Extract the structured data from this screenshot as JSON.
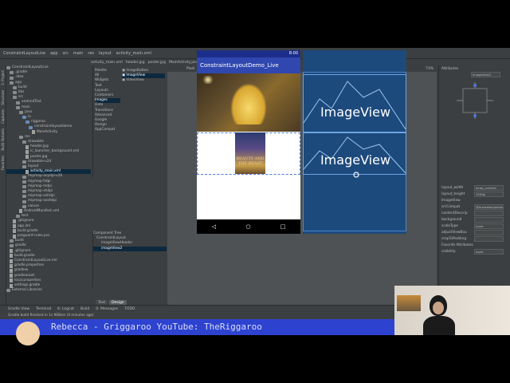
{
  "ide": {
    "top_tabs": [
      "ConstraintLayoutLive",
      "app",
      "src",
      "main",
      "res",
      "layout",
      "activity_main.xml"
    ],
    "editor_tabs": [
      "activity_main.xml",
      "header.jpg",
      "poster.jpg",
      "MainActivity.java",
      "app"
    ],
    "project_tree": [
      {
        "label": "ConstraintLayoutLive",
        "indent": 0,
        "kind": "folder"
      },
      {
        "label": ".gradle",
        "indent": 1,
        "kind": "folder"
      },
      {
        "label": ".idea",
        "indent": 1,
        "kind": "folder"
      },
      {
        "label": "app",
        "indent": 1,
        "kind": "folder"
      },
      {
        "label": "build",
        "indent": 2,
        "kind": "folder"
      },
      {
        "label": "libs",
        "indent": 2,
        "kind": "folder"
      },
      {
        "label": "src",
        "indent": 2,
        "kind": "folder"
      },
      {
        "label": "androidTest",
        "indent": 3,
        "kind": "folder"
      },
      {
        "label": "main",
        "indent": 3,
        "kind": "folder"
      },
      {
        "label": "java",
        "indent": 4,
        "kind": "folder"
      },
      {
        "label": "io",
        "indent": 5,
        "kind": "folder-blue"
      },
      {
        "label": "riggaroo",
        "indent": 6,
        "kind": "folder-blue"
      },
      {
        "label": "constraintlayoutdemo",
        "indent": 7,
        "kind": "folder-blue"
      },
      {
        "label": "MainActivity",
        "indent": 8,
        "kind": "file"
      },
      {
        "label": "res",
        "indent": 4,
        "kind": "folder"
      },
      {
        "label": "drawable",
        "indent": 5,
        "kind": "folder"
      },
      {
        "label": "header.jpg",
        "indent": 6,
        "kind": "file"
      },
      {
        "label": "ic_launcher_background.xml",
        "indent": 6,
        "kind": "file"
      },
      {
        "label": "poster.jpg",
        "indent": 6,
        "kind": "file"
      },
      {
        "label": "drawable-v24",
        "indent": 5,
        "kind": "folder"
      },
      {
        "label": "layout",
        "indent": 5,
        "kind": "folder"
      },
      {
        "label": "activity_main.xml",
        "indent": 6,
        "kind": "file",
        "selected": true
      },
      {
        "label": "mipmap-anydpi-v26",
        "indent": 5,
        "kind": "folder"
      },
      {
        "label": "mipmap-hdpi",
        "indent": 5,
        "kind": "folder"
      },
      {
        "label": "mipmap-mdpi",
        "indent": 5,
        "kind": "folder"
      },
      {
        "label": "mipmap-xhdpi",
        "indent": 5,
        "kind": "folder"
      },
      {
        "label": "mipmap-xxhdpi",
        "indent": 5,
        "kind": "folder"
      },
      {
        "label": "mipmap-xxxhdpi",
        "indent": 5,
        "kind": "folder"
      },
      {
        "label": "values",
        "indent": 5,
        "kind": "folder"
      },
      {
        "label": "AndroidManifest.xml",
        "indent": 4,
        "kind": "file"
      },
      {
        "label": "test",
        "indent": 3,
        "kind": "folder"
      },
      {
        "label": ".gitignore",
        "indent": 2,
        "kind": "file"
      },
      {
        "label": "app.iml",
        "indent": 2,
        "kind": "file"
      },
      {
        "label": "build.gradle",
        "indent": 2,
        "kind": "file"
      },
      {
        "label": "proguard-rules.pro",
        "indent": 2,
        "kind": "file"
      },
      {
        "label": "build",
        "indent": 1,
        "kind": "folder"
      },
      {
        "label": "gradle",
        "indent": 1,
        "kind": "folder"
      },
      {
        "label": ".gitignore",
        "indent": 1,
        "kind": "file"
      },
      {
        "label": "build.gradle",
        "indent": 1,
        "kind": "file"
      },
      {
        "label": "ConstraintLayoutLive.iml",
        "indent": 1,
        "kind": "file"
      },
      {
        "label": "gradle.properties",
        "indent": 1,
        "kind": "file"
      },
      {
        "label": "gradlew",
        "indent": 1,
        "kind": "file"
      },
      {
        "label": "gradlew.bat",
        "indent": 1,
        "kind": "file"
      },
      {
        "label": "local.properties",
        "indent": 1,
        "kind": "file"
      },
      {
        "label": "settings.gradle",
        "indent": 1,
        "kind": "file"
      },
      {
        "label": "External Libraries",
        "indent": 0,
        "kind": "folder"
      }
    ],
    "palette": {
      "title": "Palette",
      "categories": [
        "All",
        "Widgets",
        "Text",
        "Layouts",
        "Containers",
        "Images",
        "Date",
        "Transitions",
        "Advanced",
        "Google",
        "Design",
        "AppCompat"
      ],
      "selected_category": "Images",
      "items": [
        "ImageButton",
        "ImageView",
        "VideoView"
      ],
      "selected_item": "ImageView"
    },
    "component_tree": {
      "title": "Component Tree",
      "items": [
        "ConstraintLayout",
        "imageViewHeader",
        "imageView2"
      ],
      "selected": "imageView2"
    },
    "canvas_toolbar": [
      "Pixel",
      "28",
      "AppTheme",
      "Language"
    ],
    "zoom": "73%",
    "phone": {
      "status_time": "8:00",
      "app_title": "ConstraintLayoutDemo_Live",
      "poster_title": "BEAUTY AND THE BEAST",
      "nav_back": "◁",
      "nav_home": "○",
      "nav_recents": "□"
    },
    "blueprint": {
      "label1": "ImageView",
      "label2": "ImageView"
    },
    "attributes": {
      "title": "Attributes",
      "id_value": "imageView2",
      "rows": [
        {
          "label": "layout_width",
          "value": "wrap_content"
        },
        {
          "label": "layout_height",
          "value": "150dp"
        },
        {
          "label": "ImageView",
          "value": ""
        },
        {
          "label": "srcCompat",
          "value": "@drawable/poster"
        },
        {
          "label": "contentDescrip",
          "value": ""
        },
        {
          "label": "background",
          "value": ""
        },
        {
          "label": "scaleType",
          "value": "none"
        },
        {
          "label": "adjustViewBou",
          "value": ""
        },
        {
          "label": "cropToPadding",
          "value": ""
        },
        {
          "label": "Favorite Attributes",
          "value": ""
        },
        {
          "label": "visibility",
          "value": "none"
        }
      ]
    },
    "design_tabs": [
      "Text",
      "Design"
    ],
    "active_design_tab": "Design",
    "bottom_tools": [
      "Gradle View",
      "Terminal",
      "6: Logcat",
      "Build",
      "0: Messages",
      "TODO"
    ],
    "status_message": "Gradle build finished in 1s 968ms (4 minutes ago)",
    "left_tools": [
      "1: Project",
      "Structure",
      "Captures",
      "Build Variants",
      "Favorites"
    ]
  },
  "banner": {
    "text": "Rebecca - Griggaroo YouTube: TheRiggaroo"
  },
  "colors": {
    "ide_bg": "#3c3f41",
    "blueprint": "#1d4a7d",
    "app_bar": "#3047b0",
    "status_bar": "#1c2e8a",
    "banner": "#2d43d0"
  }
}
